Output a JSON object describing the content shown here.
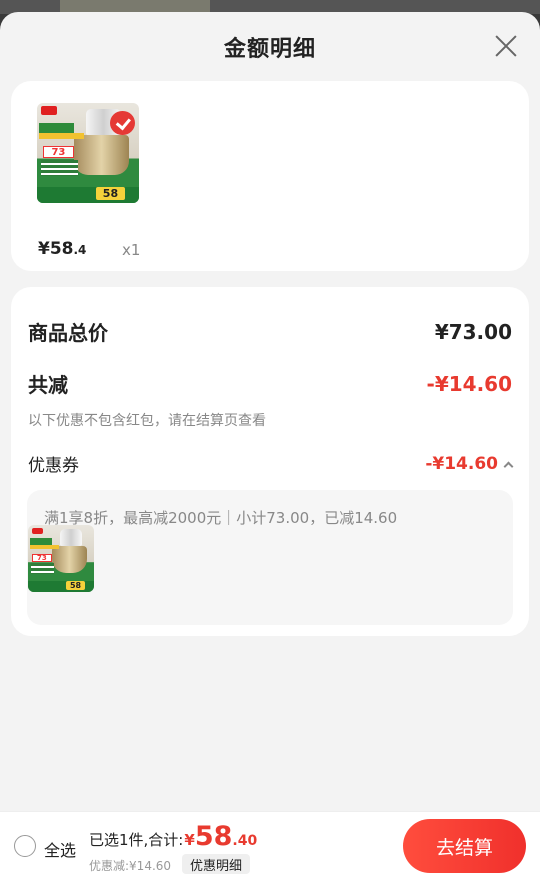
{
  "sheet": {
    "title": "金额明细",
    "close_icon": "close-icon"
  },
  "products": [
    {
      "price_main": "¥58",
      "price_dec": ".4",
      "qty": "x1",
      "thumb_price_tag": "73",
      "thumb_sale_tag": "58"
    }
  ],
  "summary": {
    "total_label": "商品总价",
    "total_value": "¥73.00",
    "reduce_label": "共减",
    "reduce_value": "-¥14.60",
    "note": "以下优惠不包含红包，请在结算页查看",
    "coupon_label": "优惠券",
    "coupon_value": "-¥14.60",
    "coupon_desc": "满1享8折，最高减2000元｜小计73.00，已减14.60"
  },
  "footer": {
    "select_all": "全选",
    "selected_label": "已选1件,合计:",
    "currency": "¥",
    "total_int": "58",
    "total_dec": ".40",
    "discount_line": "优惠减:¥14.60",
    "detail_button": "优惠明细",
    "checkout_button": "去结算"
  },
  "colors": {
    "accent_red": "#e83a2f",
    "checkout_gradient_start": "#ff4d3d",
    "checkout_gradient_end": "#f0302c"
  }
}
